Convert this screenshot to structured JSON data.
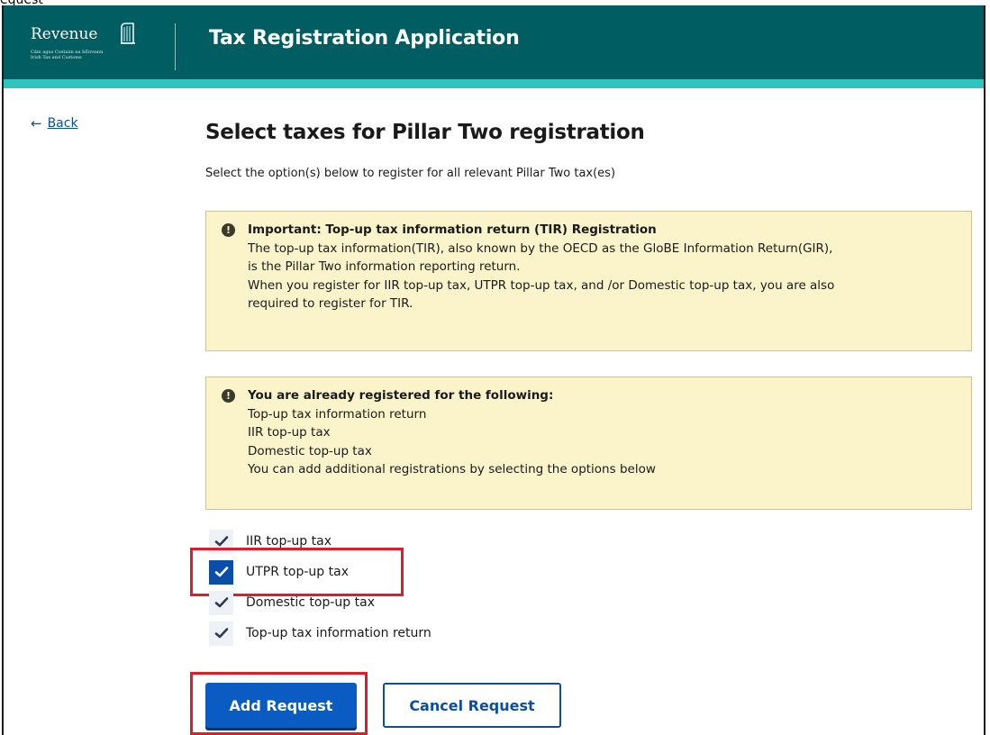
{
  "caption": "equest",
  "header": {
    "logo_word": "Revenue",
    "logo_line1": "Cáin agus Custaim na hÉireann",
    "logo_line2": "Irish Tax and Customs",
    "title": "Tax Registration Application"
  },
  "nav": {
    "back_label": "Back"
  },
  "main": {
    "title": "Select taxes for Pillar Two registration",
    "intro": "Select the option(s) below to register for all relevant Pillar Two tax(es)",
    "notice_important": {
      "title": "Important: Top-up tax information return (TIR) Registration",
      "lines": [
        "The top-up tax information(TIR), also known by the OECD as the GloBE Information Return(GIR),",
        "is the Pillar Two information reporting return.",
        "When you register for IIR top-up tax, UTPR top-up tax, and /or Domestic top-up tax, you are also",
        "required to register for TIR."
      ]
    },
    "notice_registered": {
      "title": "You are already registered for the following:",
      "lines": [
        "Top-up tax information return",
        "IIR top-up tax",
        "Domestic top-up tax",
        "You can add additional registrations by selecting the options below"
      ]
    },
    "options": [
      {
        "label": "IIR top-up tax",
        "checked": true,
        "disabled": true
      },
      {
        "label": "UTPR top-up tax",
        "checked": true,
        "disabled": false
      },
      {
        "label": "Domestic top-up tax",
        "checked": true,
        "disabled": true
      },
      {
        "label": "Top-up tax information return",
        "checked": true,
        "disabled": true
      }
    ],
    "actions": {
      "add_label": "Add Request",
      "cancel_label": "Cancel Request"
    }
  },
  "colors": {
    "header_bg": "#005e62",
    "header_stripe": "#2ec4c0",
    "link": "#0b4ea2",
    "primary_button": "#0a5cc2",
    "notice_bg": "#fbf4cb",
    "highlight": "#e21b2a"
  },
  "icons": {
    "back": "arrow-left-icon",
    "notice": "exclamation-circle-icon",
    "check": "checkmark-icon",
    "logo": "harp-icon"
  }
}
